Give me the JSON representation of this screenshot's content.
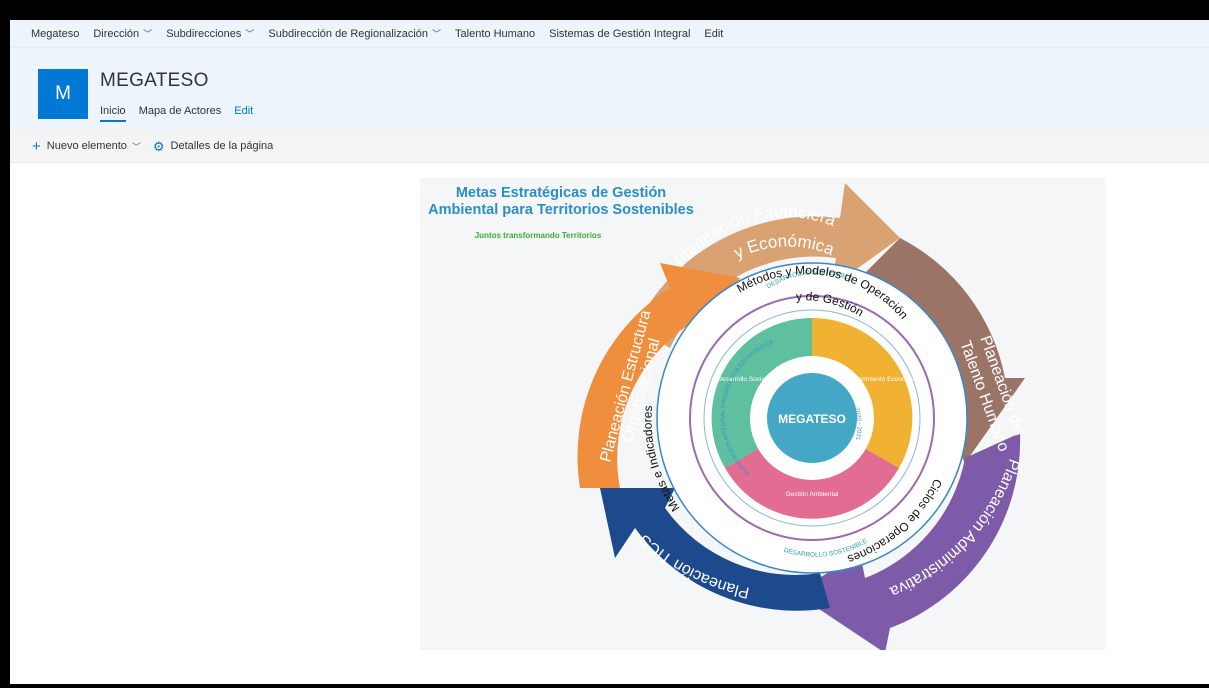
{
  "top_nav": {
    "items": [
      {
        "label": "Megateso",
        "has_dropdown": false
      },
      {
        "label": "Dirección",
        "has_dropdown": true
      },
      {
        "label": "Subdirecciones",
        "has_dropdown": true
      },
      {
        "label": "Subdirección de Regionalización",
        "has_dropdown": true
      },
      {
        "label": "Talento Humano",
        "has_dropdown": false
      },
      {
        "label": "Sistemas de Gestión Integral",
        "has_dropdown": false
      },
      {
        "label": "Edit",
        "has_dropdown": false
      }
    ]
  },
  "site": {
    "logo_letter": "M",
    "title": "MEGATESO",
    "nav": {
      "home": "Inicio",
      "actors": "Mapa de Actores",
      "edit": "Edit"
    }
  },
  "command_bar": {
    "new_item": "Nuevo elemento",
    "page_details": "Detalles de la página"
  },
  "graphic": {
    "title_line1": "Metas Estratégicas de Gestión",
    "title_line2": "Ambiental para Territorios Sostenibles",
    "tagline": "Juntos transformando Territorios",
    "outer_ring": {
      "financial_1": "Planeación Financiera",
      "financial_2": "y Económica",
      "talent_1": "Planeación del",
      "talent_2": "Talento Humano",
      "admin": "Planeación Administrativa",
      "tics": "Planeación TICS",
      "structure_1": "Planeación Estructura",
      "structure_2": "Organizacional"
    },
    "inner_ring": {
      "methods_1": "Métodos y Modelos de Operación",
      "methods_2": "y de Gestión",
      "cycles": "Ciclos de Operaciones",
      "goals": "Metas e Indicadores"
    },
    "core": {
      "sustainable_top": "DESARROLLO SOSTENIBLE",
      "sustainable_bottom": "DESARROLLO SOSTENIBLE",
      "prospective": "PLANEACION INTEGRAL PROSPECTIVA ESTRATEGICA",
      "years": "2020 - 2031",
      "social": "Desarrollo Social",
      "economic": "Crecimiento Económico",
      "environmental": "Gestión Ambiental",
      "center": "MEGATESO"
    },
    "colors": {
      "financial": "#d8a273",
      "talent": "#9b7468",
      "admin": "#7e5ba8",
      "tics": "#1d4a8c",
      "structure": "#ef8e3c",
      "social": "#5fc0a0",
      "economic": "#f1b133",
      "environmental": "#e36c92",
      "center": "#44a7c6",
      "title": "#2a8fc6",
      "tagline": "#3aab3a"
    }
  }
}
